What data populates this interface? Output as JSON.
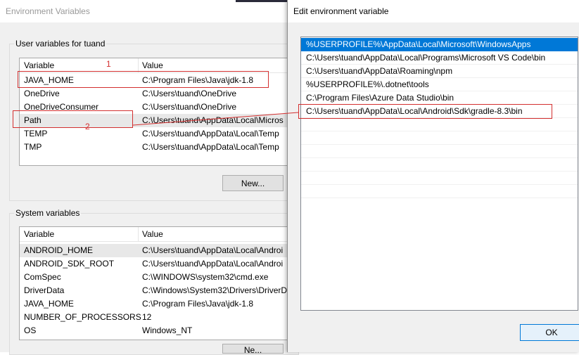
{
  "env_dialog": {
    "title": "Environment Variables",
    "user_group_label": "User variables for tuand",
    "system_group_label": "System variables",
    "col_variable": "Variable",
    "col_value": "Value",
    "user_rows": [
      {
        "name": "JAVA_HOME",
        "value": "C:\\Program Files\\Java\\jdk-1.8"
      },
      {
        "name": "OneDrive",
        "value": "C:\\Users\\tuand\\OneDrive"
      },
      {
        "name": "OneDriveConsumer",
        "value": "C:\\Users\\tuand\\OneDrive"
      },
      {
        "name": "Path",
        "value": "C:\\Users\\tuand\\AppData\\Local\\Micros"
      },
      {
        "name": "TEMP",
        "value": "C:\\Users\\tuand\\AppData\\Local\\Temp"
      },
      {
        "name": "TMP",
        "value": "C:\\Users\\tuand\\AppData\\Local\\Temp"
      }
    ],
    "system_rows": [
      {
        "name": "ANDROID_HOME",
        "value": "C:\\Users\\tuand\\AppData\\Local\\Androi"
      },
      {
        "name": "ANDROID_SDK_ROOT",
        "value": "C:\\Users\\tuand\\AppData\\Local\\Androi"
      },
      {
        "name": "ComSpec",
        "value": "C:\\WINDOWS\\system32\\cmd.exe"
      },
      {
        "name": "DriverData",
        "value": "C:\\Windows\\System32\\Drivers\\DriverD"
      },
      {
        "name": "JAVA_HOME",
        "value": "C:\\Program Files\\Java\\jdk-1.8"
      },
      {
        "name": "NUMBER_OF_PROCESSORS",
        "value": "12"
      },
      {
        "name": "OS",
        "value": "Windows_NT"
      }
    ],
    "new_button_user": "New...",
    "new_button_system": "Ne..."
  },
  "edit_dialog": {
    "title": "Edit environment variable",
    "entries": [
      "%USERPROFILE%\\AppData\\Local\\Microsoft\\WindowsApps",
      "C:\\Users\\tuand\\AppData\\Local\\Programs\\Microsoft VS Code\\bin",
      "C:\\Users\\tuand\\AppData\\Roaming\\npm",
      "%USERPROFILE%\\.dotnet\\tools",
      "C:\\Program Files\\Azure Data Studio\\bin",
      "C:\\Users\\tuand\\AppData\\Local\\Android\\Sdk\\gradle-8.3\\bin"
    ],
    "ok_label": "OK"
  },
  "annotations": {
    "label_1": "1",
    "label_2": "2",
    "color": "#d32f2f"
  },
  "colors": {
    "selection": "#0078d7",
    "highlight_row": "#e8e8e8"
  }
}
